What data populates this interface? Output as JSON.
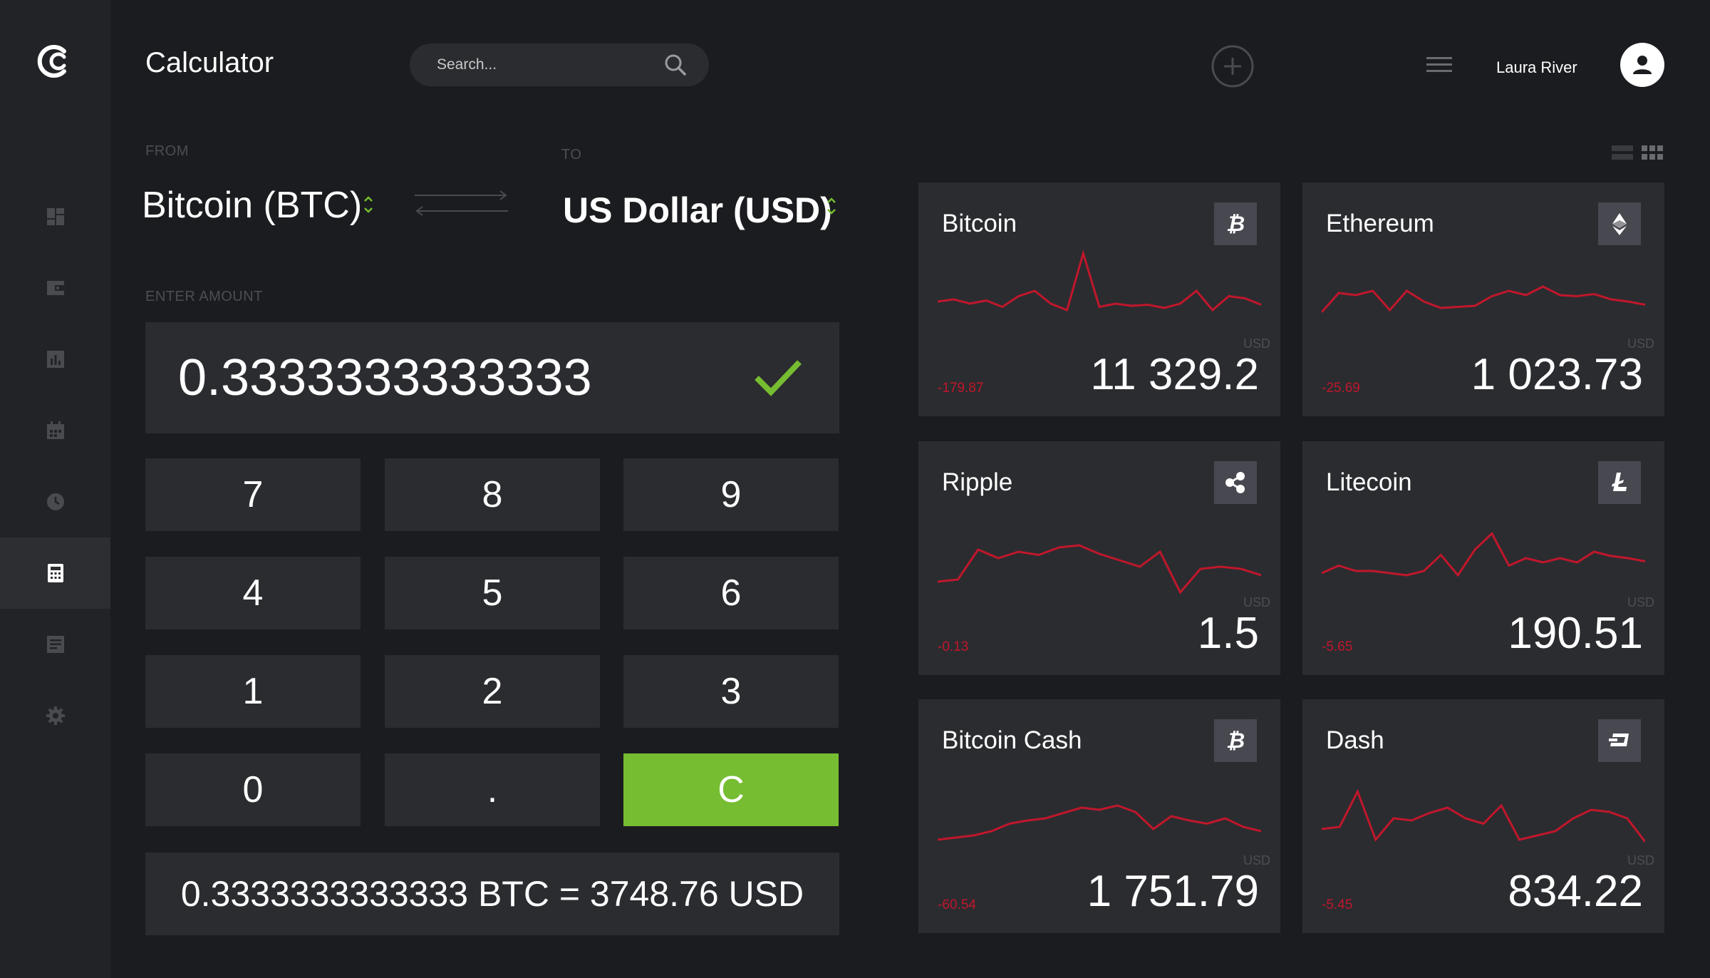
{
  "header": {
    "title": "Calculator",
    "search_placeholder": "Search...",
    "user_name": "Laura River"
  },
  "sidebar": {
    "items": [
      {
        "icon": "dashboard-icon",
        "active": false
      },
      {
        "icon": "wallet-icon",
        "active": false
      },
      {
        "icon": "bar-chart-icon",
        "active": false
      },
      {
        "icon": "calendar-icon",
        "active": false
      },
      {
        "icon": "clock-icon",
        "active": false
      },
      {
        "icon": "calculator-icon",
        "active": true
      },
      {
        "icon": "document-icon",
        "active": false
      },
      {
        "icon": "gear-icon",
        "active": false
      }
    ]
  },
  "converter": {
    "from_label": "FROM",
    "from_currency": "Bitcoin (BTC)",
    "to_label": "TO",
    "to_currency": "US Dollar (USD)",
    "amount_label": "ENTER AMOUNT",
    "amount": "0.3333333333333",
    "keys": [
      "7",
      "8",
      "9",
      "4",
      "5",
      "6",
      "1",
      "2",
      "3",
      "0",
      ".",
      "C"
    ],
    "result": "0.3333333333333 BTC = 3748.76 USD"
  },
  "cards": [
    {
      "name": "Bitcoin",
      "icon": "bitcoin-icon",
      "currency": "USD",
      "change": "-179.87",
      "value": "11 329.2",
      "series": [
        50,
        52,
        48,
        51,
        45,
        55,
        60,
        48,
        42,
        95,
        45,
        48,
        46,
        47,
        44,
        48,
        60,
        42,
        55,
        53,
        47
      ]
    },
    {
      "name": "Ethereum",
      "icon": "ethereum-icon",
      "currency": "USD",
      "change": "-25.69",
      "value": "1 023.73",
      "series": [
        40,
        58,
        56,
        60,
        42,
        60,
        50,
        44,
        45,
        46,
        55,
        60,
        56,
        64,
        56,
        55,
        57,
        52,
        50,
        47
      ]
    },
    {
      "name": "Ripple",
      "icon": "ripple-icon",
      "currency": "USD",
      "change": "-0.13",
      "value": "1.5",
      "series": [
        30,
        32,
        60,
        52,
        58,
        55,
        62,
        64,
        56,
        50,
        44,
        58,
        20,
        42,
        44,
        42,
        36
      ]
    },
    {
      "name": "Litecoin",
      "icon": "litecoin-icon",
      "currency": "USD",
      "change": "-5.65",
      "value": "190.51",
      "series": [
        38,
        45,
        40,
        40,
        38,
        36,
        40,
        55,
        36,
        60,
        75,
        45,
        52,
        48,
        52,
        48,
        58,
        54,
        52,
        49
      ]
    },
    {
      "name": "Bitcoin Cash",
      "icon": "bitcoin-cash-icon",
      "currency": "USD",
      "change": "-60.54",
      "value": "1 751.79",
      "series": [
        30,
        32,
        34,
        38,
        45,
        48,
        50,
        55,
        60,
        58,
        62,
        56,
        40,
        52,
        48,
        45,
        50,
        42,
        38
      ]
    },
    {
      "name": "Dash",
      "icon": "dash-icon",
      "currency": "USD",
      "change": "-5.45",
      "value": "834.22",
      "series": [
        40,
        42,
        75,
        30,
        50,
        48,
        55,
        60,
        50,
        45,
        62,
        30,
        34,
        38,
        50,
        58,
        56,
        50,
        28
      ]
    }
  ],
  "colors": {
    "background": "#1b1c1f",
    "sidebar": "#222326",
    "panel": "#2b2c30",
    "accent_green": "#76bd31",
    "sparkline_red": "#c0172b"
  }
}
